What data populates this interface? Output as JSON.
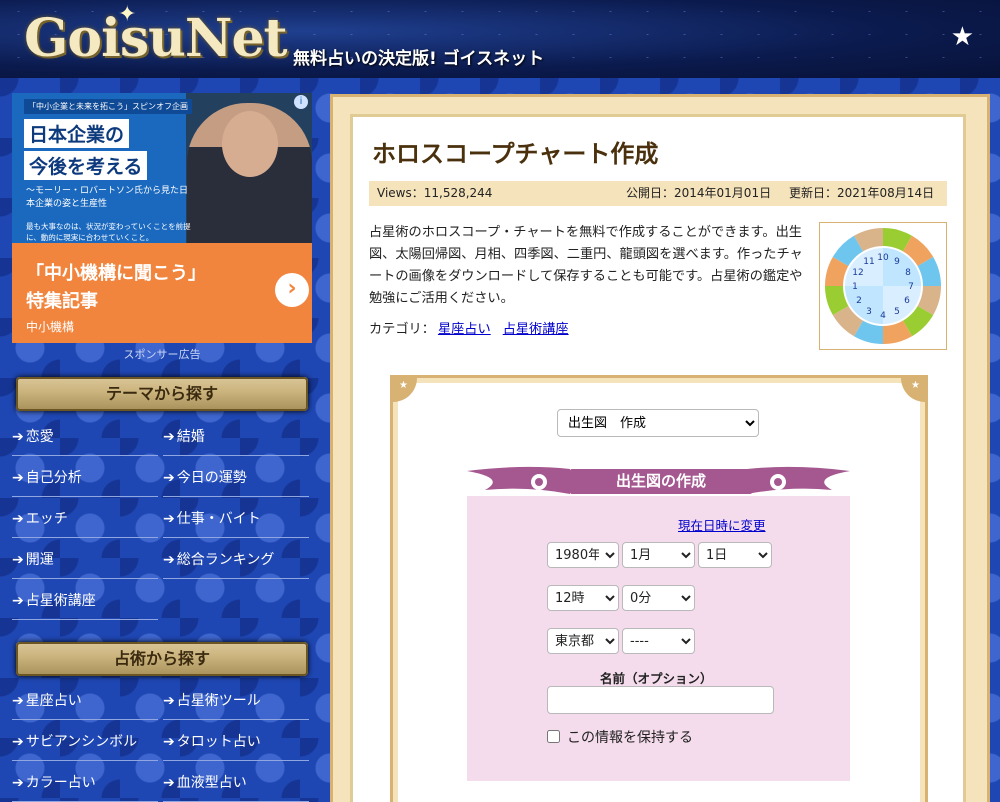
{
  "header": {
    "logo": "GoisuNet",
    "tagline": "無料占いの決定版! ゴイスネット"
  },
  "ad": {
    "kicker": "「中小企業と未来を拓こう」スピンオフ企画",
    "headline1": "日本企業の",
    "headline2": "今後を考える",
    "sub1": "〜モーリー・ロバートソン氏から見た日本企業の姿と生産性",
    "sub2": "最も大事なのは、状況が変わっていくことを前提に、動的に現実に合わせていくこと。",
    "cta1": "「中小機構に聞こう」",
    "cta2": "特集記事",
    "brand": "中小機構",
    "sponsor_label": "スポンサー広告"
  },
  "sidebar": {
    "theme_title": "テーマから探す",
    "theme_items": [
      {
        "label": "恋愛"
      },
      {
        "label": "結婚"
      },
      {
        "label": "自己分析"
      },
      {
        "label": "今日の運勢"
      },
      {
        "label": "エッチ"
      },
      {
        "label": "仕事・バイト"
      },
      {
        "label": "開運"
      },
      {
        "label": "総合ランキング"
      },
      {
        "label": "占星術講座"
      }
    ],
    "fortune_title": "占術から探す",
    "fortune_items": [
      {
        "label": "星座占い"
      },
      {
        "label": "占星術ツール"
      },
      {
        "label": "サビアンシンボル"
      },
      {
        "label": "タロット占い"
      },
      {
        "label": "カラー占い"
      },
      {
        "label": "血液型占い"
      }
    ]
  },
  "main": {
    "title": "ホロスコープチャート作成",
    "views": "Views：11,528,244",
    "published": "公開日：2014年01月01日",
    "updated": "更新日：2021年08月14日",
    "description": "占星術のホロスコープ・チャートを無料で作成することができます。出生図、太陽回帰図、月相、四季図、二重円、龍頭図を選べます。作ったチャートの画像をダウンロードして保存することも可能です。占星術の鑑定や勉強にご活用ください。",
    "category_label": "カテゴリ：",
    "categories": [
      "星座占い",
      "占星術講座"
    ]
  },
  "form": {
    "chart_type": "出生図　作成",
    "header": "出生図の作成",
    "now_link": "現在日時に変更",
    "year": "1980年",
    "month": "1月",
    "day": "1日",
    "hour": "12時",
    "minute": "0分",
    "prefecture": "東京都",
    "city": "----",
    "name_label": "名前（オプション）",
    "name_value": "",
    "remember_label": "この情報を保持する"
  },
  "colors": {
    "accent": "#a4588f",
    "gold": "#d7b272",
    "link": "#0000cc"
  }
}
